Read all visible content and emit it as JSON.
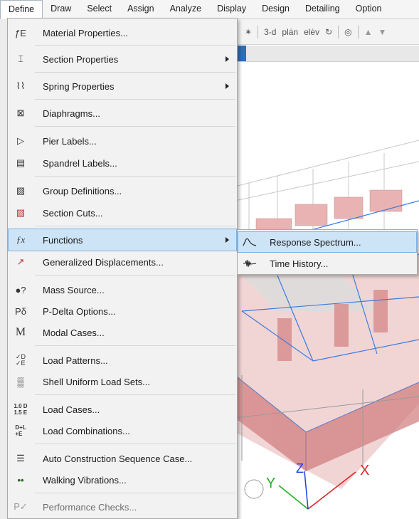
{
  "menubar": {
    "items": [
      "Define",
      "Draw",
      "Select",
      "Assign",
      "Analyze",
      "Display",
      "Design",
      "Detailing",
      "Option"
    ]
  },
  "toolbar": {
    "view_3d": "3-d",
    "plan": "plȧn",
    "elev": "elėv"
  },
  "define_menu": {
    "items": [
      {
        "label": "Material Properties...",
        "icon": "material-properties-icon",
        "glyph": "ƒE",
        "submenu": false
      },
      {
        "label": "Section Properties",
        "icon": "section-properties-icon",
        "glyph": "I",
        "submenu": true
      },
      {
        "label": "Spring Properties",
        "icon": "spring-properties-icon",
        "glyph": "⌇",
        "submenu": true
      },
      {
        "label": "Diaphragms...",
        "icon": "diaphragms-icon",
        "glyph": "⊠",
        "submenu": false
      },
      {
        "label": "Pier Labels...",
        "icon": "pier-labels-icon",
        "glyph": "▷",
        "submenu": false
      },
      {
        "label": "Spandrel Labels...",
        "icon": "spandrel-labels-icon",
        "glyph": "▤",
        "submenu": false
      },
      {
        "label": "Group Definitions...",
        "icon": "group-definitions-icon",
        "glyph": "▨",
        "submenu": false
      },
      {
        "label": "Section Cuts...",
        "icon": "section-cuts-icon",
        "glyph": "▧",
        "submenu": false
      },
      {
        "label": "Functions",
        "icon": "functions-icon",
        "glyph": "ƒx",
        "submenu": true,
        "highlighted": true
      },
      {
        "label": "Generalized Displacements...",
        "icon": "generalized-displacements-icon",
        "glyph": "↗",
        "submenu": false
      },
      {
        "label": "Mass Source...",
        "icon": "mass-source-icon",
        "glyph": "●?",
        "submenu": false
      },
      {
        "label": "P-Delta Options...",
        "icon": "p-delta-icon",
        "glyph": "Pδ",
        "submenu": false
      },
      {
        "label": "Modal Cases...",
        "icon": "modal-cases-icon",
        "glyph": "M",
        "submenu": false
      },
      {
        "label": "Load Patterns...",
        "icon": "load-patterns-icon",
        "glyph": "✓D",
        "submenu": false
      },
      {
        "label": "Shell Uniform Load Sets...",
        "icon": "shell-uniform-load-sets-icon",
        "glyph": "▒",
        "submenu": false
      },
      {
        "label": "Load Cases...",
        "icon": "load-cases-icon",
        "glyph": "1.0D",
        "submenu": false
      },
      {
        "label": "Load Combinations...",
        "icon": "load-combinations-icon",
        "glyph": "D+L",
        "submenu": false
      },
      {
        "label": "Auto Construction Sequence Case...",
        "icon": "auto-construction-sequence-icon",
        "glyph": "☰",
        "submenu": false
      },
      {
        "label": "Walking Vibrations...",
        "icon": "walking-vibrations-icon",
        "glyph": "••",
        "submenu": false
      },
      {
        "label": "Performance Checks...",
        "icon": "performance-checks-icon",
        "glyph": "P✓",
        "submenu": false,
        "disabled": true
      }
    ]
  },
  "functions_submenu": {
    "items": [
      {
        "label": "Response Spectrum...",
        "icon": "response-spectrum-icon",
        "highlighted": true
      },
      {
        "label": "Time History...",
        "icon": "time-history-icon"
      }
    ]
  },
  "viewport": {
    "axis_x": "X",
    "axis_y": "Y",
    "axis_z": "Z"
  },
  "colors": {
    "highlight": "#cde4f7",
    "highlight_border": "#7fb2e1",
    "model_wall": "#e5a9a9",
    "model_lines": "#3b7be0",
    "axis_x": "#e02020",
    "axis_y": "#20b020",
    "axis_z": "#2040e0"
  }
}
